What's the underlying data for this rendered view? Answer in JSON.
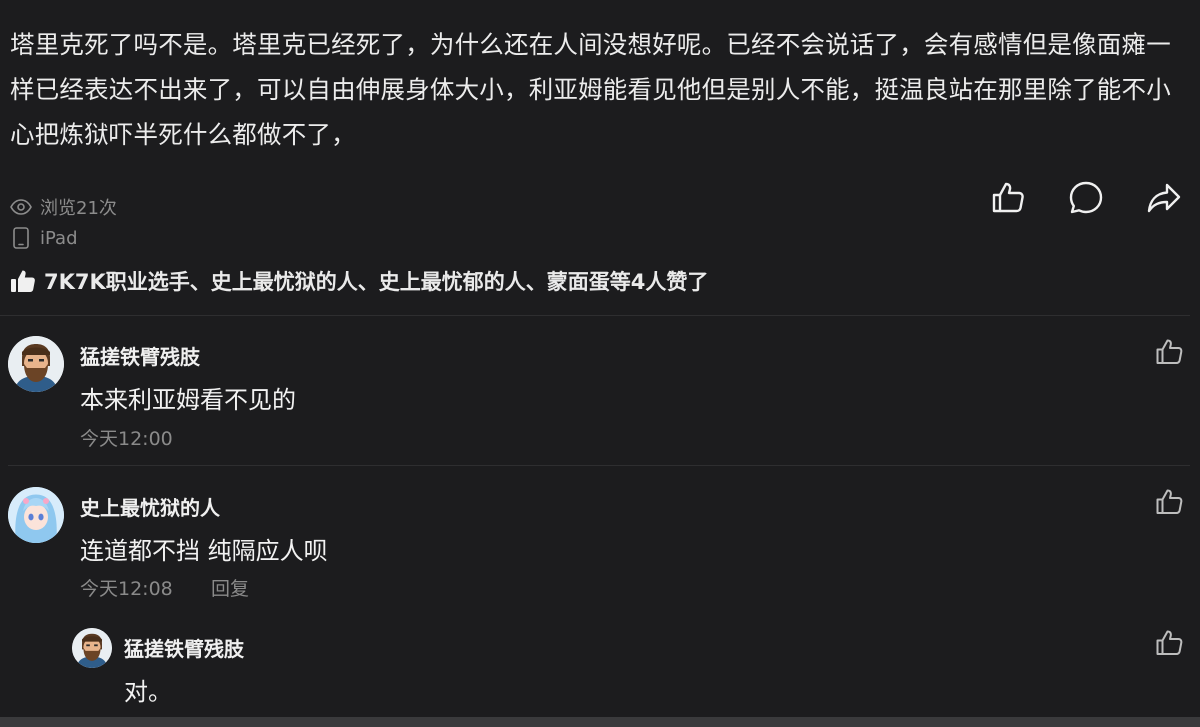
{
  "post": {
    "text": "塔里克死了吗不是。塔里克已经死了，为什么还在人间没想好呢。已经不会说话了，会有感情但是像面瘫一样已经表达不出来了，可以自由伸展身体大小，利亚姆能看见他但是别人不能，挺温良站在那里除了能不小心把炼狱吓半死什么都做不了，",
    "views": "浏览21次",
    "device": "iPad",
    "likes_text": "7K7K职业选手、史上最忧狱的人、史上最忧郁的人、蒙面蛋等4人赞了"
  },
  "actions": {
    "like_icon": "thumbs-up-icon",
    "comment_icon": "comment-icon",
    "share_icon": "share-icon"
  },
  "comments": [
    {
      "name": "猛搓铁臂残肢",
      "body": "本来利亚姆看不见的",
      "time": "今天12:00"
    },
    {
      "name": "史上最忧狱的人",
      "body": "连道都不挡 纯隔应人呗",
      "time": "今天12:08",
      "reply": "回复"
    }
  ],
  "reply": {
    "name": "猛搓铁臂残肢",
    "body": "对。"
  },
  "colors": {
    "background": "#1c1c1e",
    "text": "#ececec",
    "muted": "#8a8a8a"
  }
}
